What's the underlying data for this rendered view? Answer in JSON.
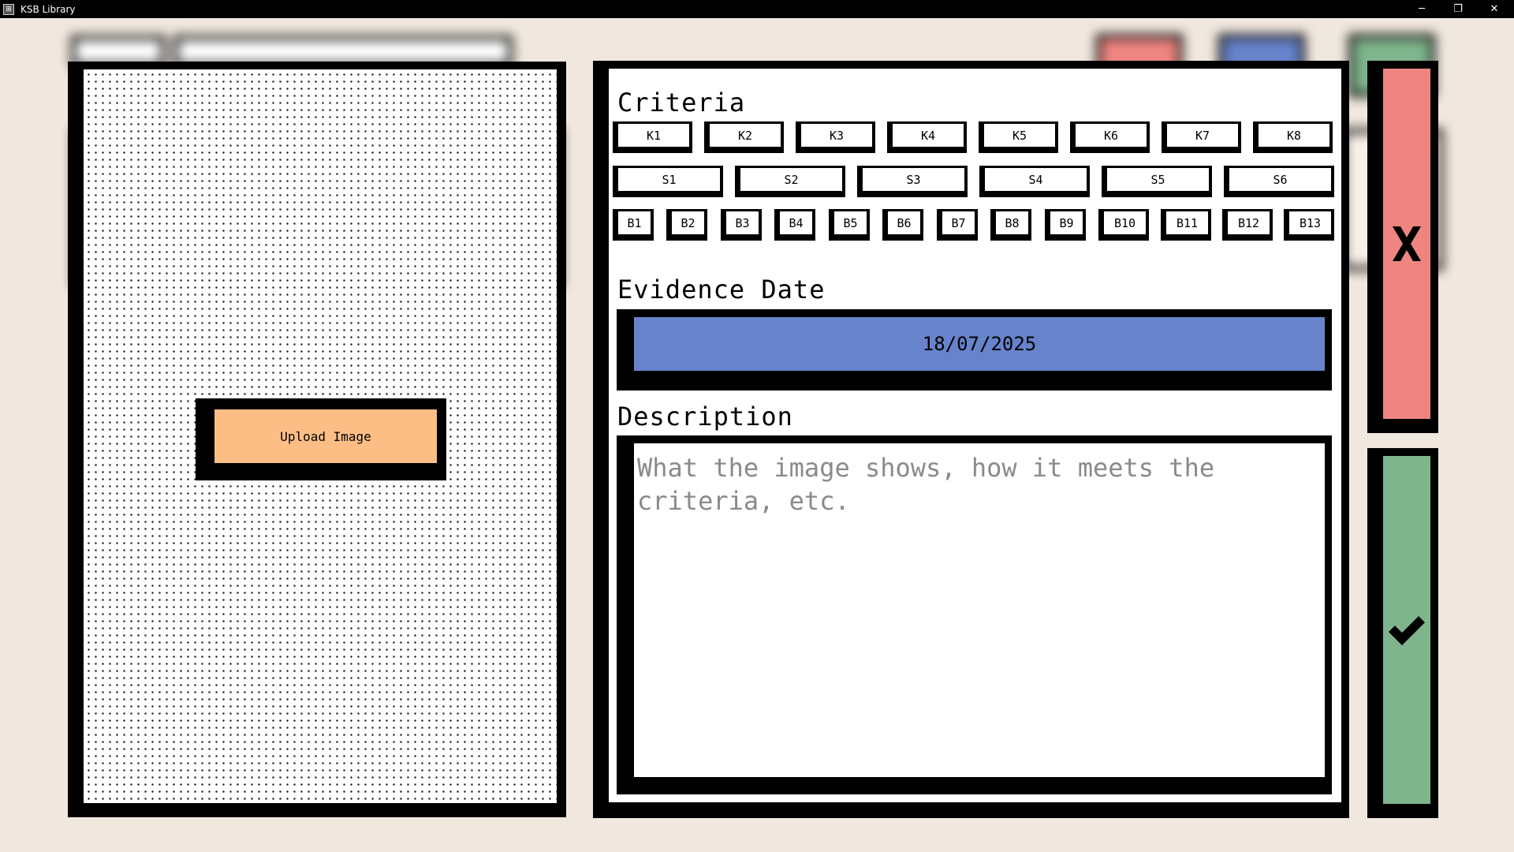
{
  "window": {
    "title": "KSB Library",
    "app_icon": "library-app-icon",
    "controls": {
      "minimize": "─",
      "restore": "❐",
      "close": "✕"
    }
  },
  "image_panel": {
    "upload_label": "Upload Image",
    "upload_color": "#fdbe86"
  },
  "form": {
    "criteria_label": "Criteria",
    "knowledge": [
      "K1",
      "K2",
      "K3",
      "K4",
      "K5",
      "K6",
      "K7",
      "K8"
    ],
    "skills": [
      "S1",
      "S2",
      "S3",
      "S4",
      "S5",
      "S6"
    ],
    "behaviours": [
      "B1",
      "B2",
      "B3",
      "B4",
      "B5",
      "B6",
      "B7",
      "B8",
      "B9",
      "B10",
      "B11",
      "B12",
      "B13"
    ],
    "evidence_date_label": "Evidence Date",
    "evidence_date_value": "18/07/2025",
    "evidence_date_color": "#6683cb",
    "description_label": "Description",
    "description_value": "",
    "description_placeholder": "What the image shows, how it meets the criteria, etc."
  },
  "actions": {
    "cancel_icon": "close-x-icon",
    "cancel_glyph": "✘",
    "cancel_color": "#ee8581",
    "confirm_icon": "checkmark-icon",
    "confirm_glyph": "✔",
    "confirm_color": "#7fb58c"
  }
}
